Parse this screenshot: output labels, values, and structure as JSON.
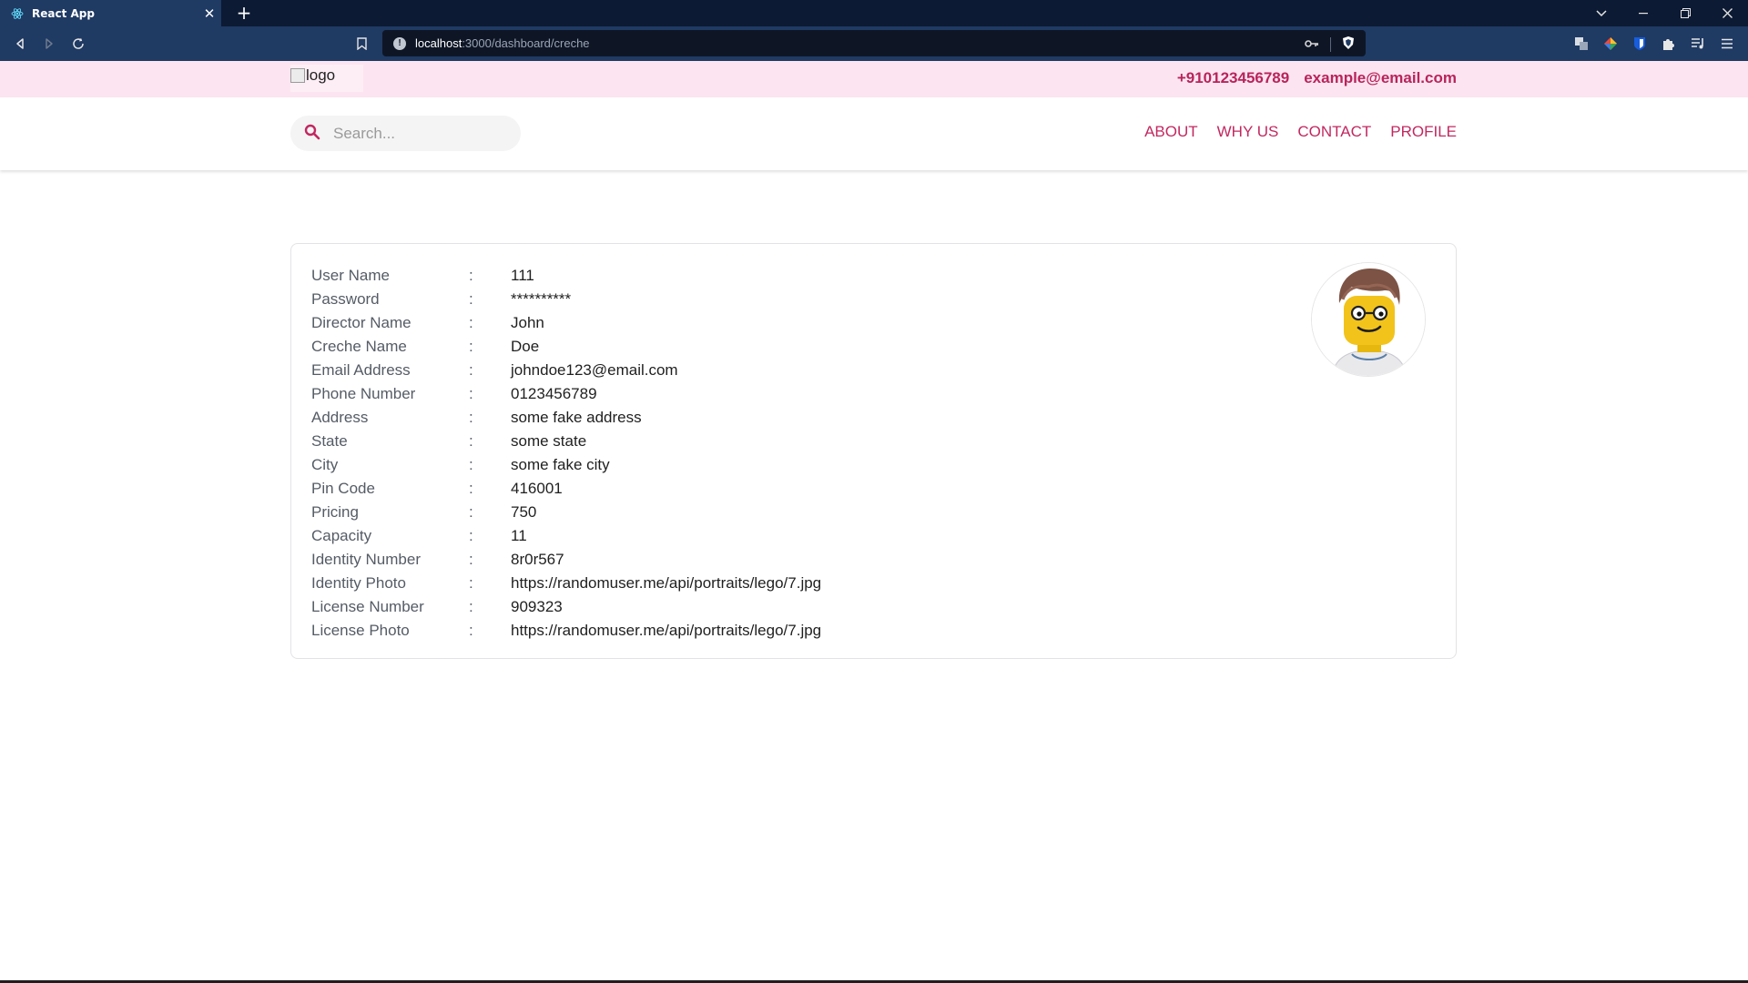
{
  "browser": {
    "tab_title": "React App",
    "tab_close": "✕",
    "new_tab": "+",
    "url_host": "localhost",
    "url_path": ":3000/dashboard/creche"
  },
  "header": {
    "logo_alt": "logo",
    "phone": "+910123456789",
    "email": "example@email.com"
  },
  "nav": {
    "search_placeholder": "Search...",
    "items": [
      "ABOUT",
      "WHY US",
      "CONTACT",
      "PROFILE"
    ]
  },
  "profile": {
    "separator": ":",
    "fields": [
      {
        "label": "User Name",
        "value": "111"
      },
      {
        "label": "Password",
        "value": "**********"
      },
      {
        "label": "Director Name",
        "value": "John"
      },
      {
        "label": "Creche Name",
        "value": "Doe"
      },
      {
        "label": "Email Address",
        "value": "johndoe123@email.com"
      },
      {
        "label": "Phone Number",
        "value": "0123456789"
      },
      {
        "label": "Address",
        "value": "some fake address"
      },
      {
        "label": "State",
        "value": "some state"
      },
      {
        "label": "City",
        "value": "some fake city"
      },
      {
        "label": "Pin Code",
        "value": "416001"
      },
      {
        "label": "Pricing",
        "value": "750"
      },
      {
        "label": "Capacity",
        "value": "11"
      },
      {
        "label": "Identity Number",
        "value": "8r0r567"
      },
      {
        "label": "Identity Photo",
        "value": "https://randomuser.me/api/portraits/lego/7.jpg"
      },
      {
        "label": "License Number",
        "value": "909323"
      },
      {
        "label": "License Photo",
        "value": "https://randomuser.me/api/portraits/lego/7.jpg"
      }
    ]
  },
  "colors": {
    "accent": "#c2285f",
    "topbar_bg": "#fce5f0",
    "chrome_bg": "#1f3a63"
  },
  "icons": {
    "search": "search-icon",
    "avatar": "lego-avatar"
  }
}
